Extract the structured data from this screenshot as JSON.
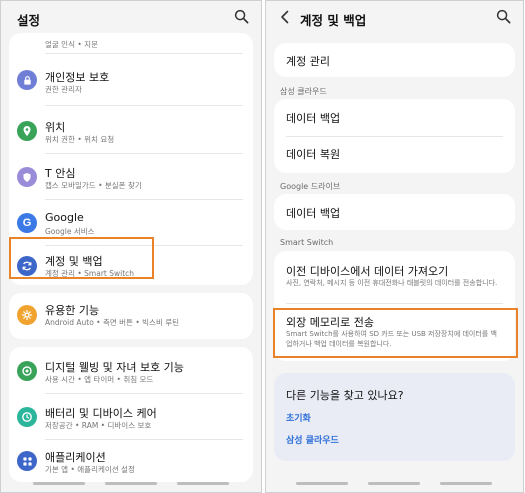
{
  "left": {
    "title": "설정",
    "partial_sub": "얼굴 인식 • 지문",
    "items": [
      {
        "title": "개인정보 보호",
        "sub": "권한 관리자",
        "color": "#6f7fd6",
        "icon": "privacy-icon"
      },
      {
        "title": "위치",
        "sub": "위치 권한 • 위치 요청",
        "color": "#3aa35a",
        "icon": "location-icon"
      },
      {
        "title": "T 안심",
        "sub": "캡스 모바일가드 • 분실폰 찾기",
        "color": "#9b8cd9",
        "icon": "t-safe-icon"
      },
      {
        "title": "Google",
        "sub": "Google 서비스",
        "color": "#3b79e6",
        "icon": "google-icon"
      },
      {
        "title": "계정 및 백업",
        "sub": "계정 관리 • Smart Switch",
        "color": "#3c67c9",
        "icon": "account-backup-icon"
      },
      {
        "title": "유용한 기능",
        "sub": "Android Auto • 측면 버튼 • 빅스비 루틴",
        "color": "#f0a32f",
        "icon": "advanced-features-icon"
      },
      {
        "title": "디지털 웰빙 및 자녀 보호 기능",
        "sub": "사용 시간 • 앱 타이머 • 취침 모드",
        "color": "#3aa35a",
        "icon": "digital-wellbeing-icon"
      },
      {
        "title": "배터리 및 디바이스 케어",
        "sub": "저장공간 • RAM • 디바이스 보호",
        "color": "#2bb59b",
        "icon": "device-care-icon"
      },
      {
        "title": "애플리케이션",
        "sub": "기본 앱 • 애플리케이션 설정",
        "color": "#3c67c9",
        "icon": "apps-icon"
      }
    ]
  },
  "right": {
    "title": "계정 및 백업",
    "account_manage": "계정 관리",
    "samsung_cloud_header": "삼성 클라우드",
    "data_backup": "데이터 백업",
    "data_restore": "데이터 복원",
    "google_drive_header": "Google 드라이브",
    "google_data_backup": "데이터 백업",
    "smart_switch_header": "Smart Switch",
    "import_title": "이전 디바이스에서 데이터 가져오기",
    "import_sub": "사진, 연락처, 메시지 등 이전 휴대전화나 태블릿의 데이터를 전송합니다.",
    "external_title": "외장 메모리로 전송",
    "external_sub": "Smart Switch를 사용하여 SD 카드 또는 USB 저장장치에 데이터를 백업하거나 백업 데이터를 복원합니다.",
    "help_question": "다른 기능을 찾고 있나요?",
    "help_reset": "초기화",
    "help_cloud": "삼성 클라우드"
  },
  "colors": {
    "highlight": "#e8832a",
    "link": "#2f6fd8"
  }
}
